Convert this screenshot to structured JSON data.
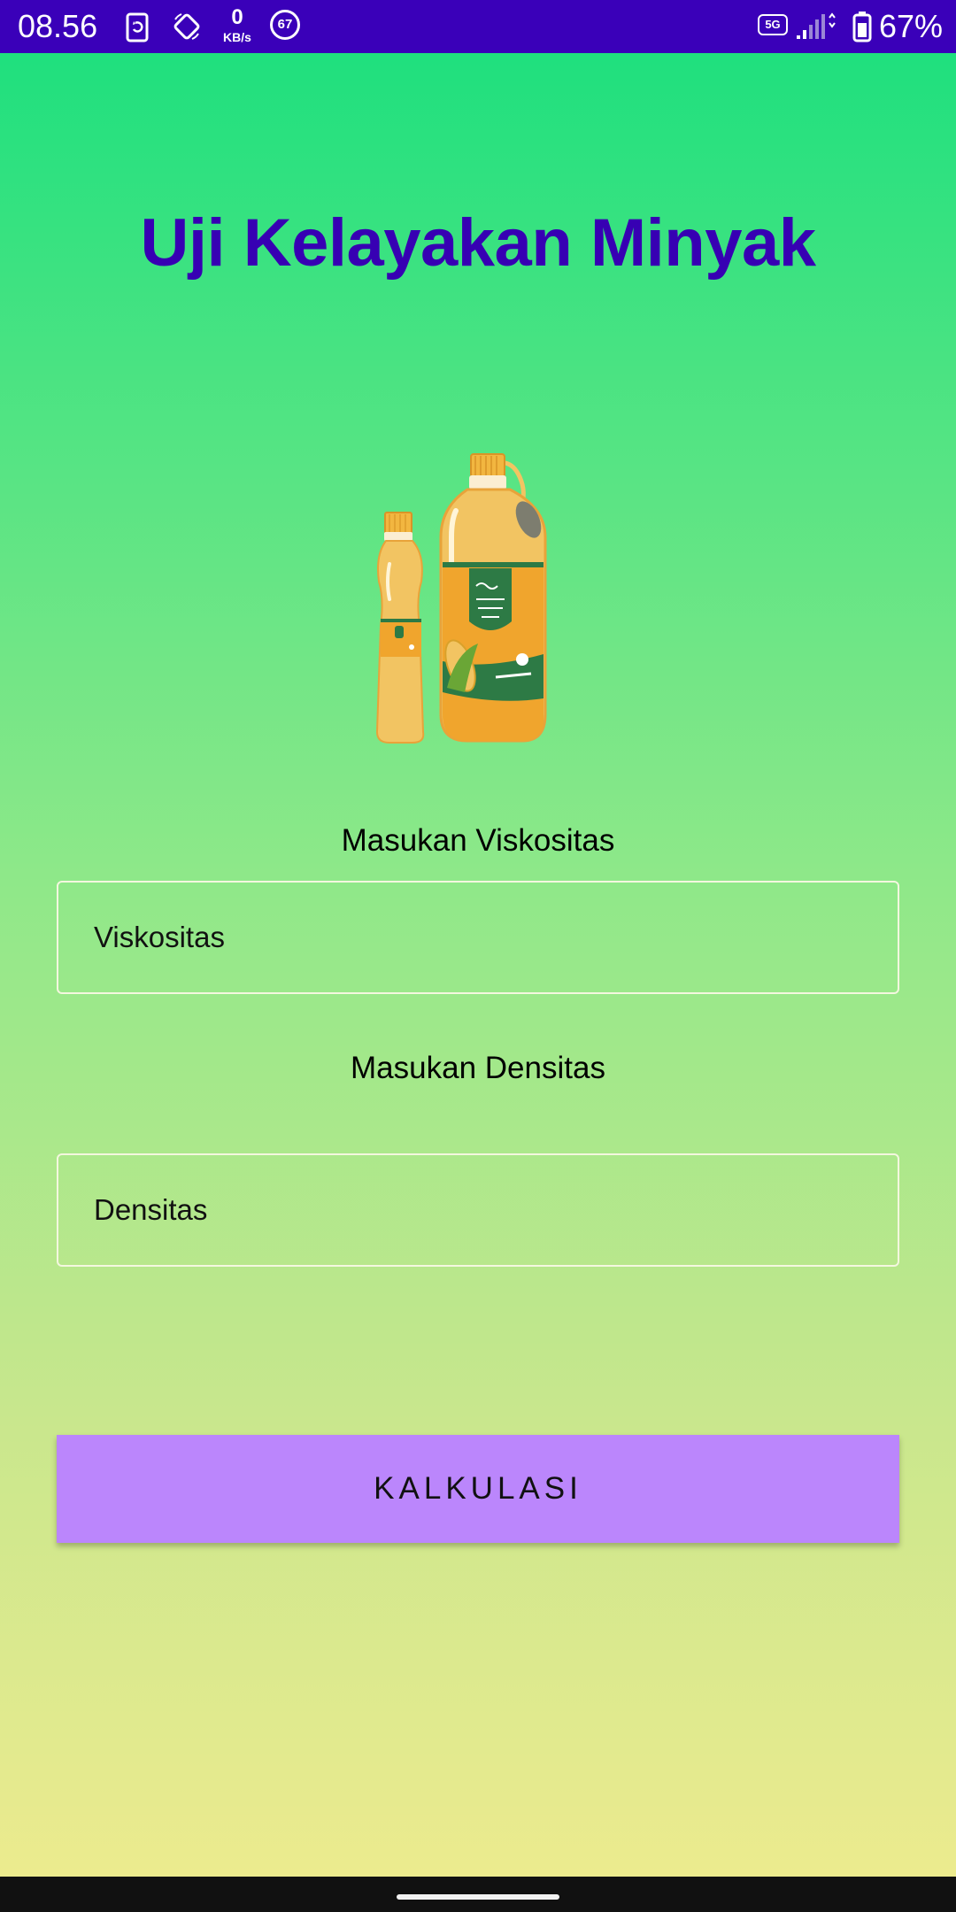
{
  "status_bar": {
    "time": "08.56",
    "net_speed_value": "0",
    "net_speed_unit": "KB/s",
    "notification_badge": "67",
    "network_type": "5G",
    "battery_percent": "67%",
    "icons": [
      "screen-record-icon",
      "rotate-icon",
      "signal-icon",
      "battery-icon"
    ]
  },
  "app": {
    "title": "Uji Kelayakan Minyak",
    "illustration": "cooking-oil-bottles-icon"
  },
  "form": {
    "viscosity_label": "Masukan Viskositas",
    "viscosity_placeholder": "Viskositas",
    "density_label": "Masukan Densitas",
    "density_placeholder": "Densitas",
    "calculate_label": "KALKULASI"
  },
  "colors": {
    "status_bar": "#3a00b9",
    "title": "#3700b3",
    "button": "#bb86fc",
    "gradient_top": "#1fe07e",
    "gradient_bottom": "#eceb8e"
  }
}
